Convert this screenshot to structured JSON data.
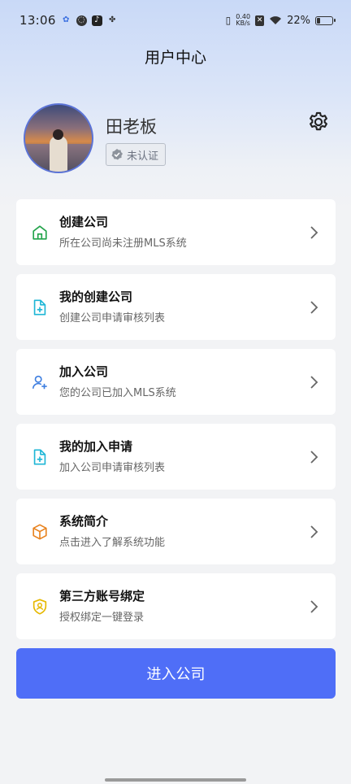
{
  "status_bar": {
    "time": "13:06",
    "net_speed_value": "0.40",
    "net_speed_unit": "KB/s",
    "battery": "22%",
    "battery_level": 0.22
  },
  "header": {
    "title": "用户中心"
  },
  "profile": {
    "name": "田老板",
    "verify_status": "未认证"
  },
  "menu": [
    {
      "title": "创建公司",
      "subtitle": "所在公司尚未注册MLS系统",
      "icon": "home-icon",
      "color": "#22a34a"
    },
    {
      "title": "我的创建公司",
      "subtitle": "创建公司申请审核列表",
      "icon": "file-add-icon",
      "color": "#1fb6d6"
    },
    {
      "title": "加入公司",
      "subtitle": "您的公司已加入MLS系统",
      "icon": "user-add-icon",
      "color": "#3f7fe0"
    },
    {
      "title": "我的加入申请",
      "subtitle": "加入公司申请审核列表",
      "icon": "file-add-icon",
      "color": "#1fb6d6"
    },
    {
      "title": "系统简介",
      "subtitle": "点击进入了解系统功能",
      "icon": "cube-icon",
      "color": "#e8831f"
    },
    {
      "title": "第三方账号绑定",
      "subtitle": "授权绑定一键登录",
      "icon": "shield-user-icon",
      "color": "#e6b800"
    }
  ],
  "primary_action": {
    "label": "进入公司",
    "color": "#4f6ef7"
  }
}
